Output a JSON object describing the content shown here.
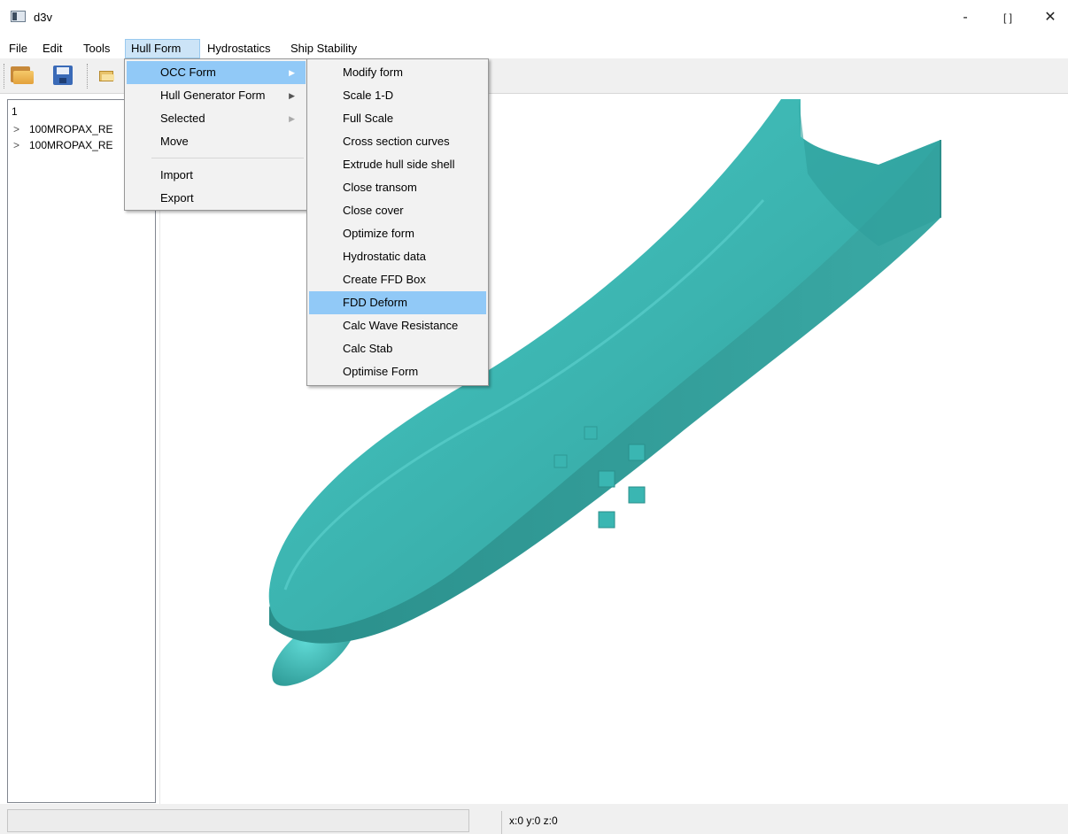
{
  "window": {
    "title": "d3v",
    "minimize": "-",
    "maximize": "[ ]",
    "close": "✕"
  },
  "menubar": {
    "items": [
      "File",
      "Edit",
      "Tools",
      "Hull Form",
      "Hydrostatics",
      "Ship Stability"
    ]
  },
  "toolbar": {
    "open_icon": "folder-open-icon",
    "save_icon": "save-icon",
    "import_icon": "open-small-icon"
  },
  "tree": {
    "root": "1",
    "items": [
      "100MROPAX_RE",
      "100MROPAX_RE"
    ]
  },
  "hull_form_menu": {
    "items": [
      "OCC Form",
      "Hull Generator Form",
      "Selected",
      "Move",
      "Import",
      "Export"
    ],
    "highlighted": "OCC Form"
  },
  "occ_form_menu": {
    "items": [
      "Modify form",
      "Scale 1-D",
      "Full Scale",
      "Cross section curves",
      "Extrude hull side shell",
      "Close transom",
      "Close cover",
      "Optimize form",
      "Hydrostatic data",
      "Create FFD Box",
      "FDD Deform",
      "Calc Wave Resistance",
      "Calc Stab",
      "Optimise Form"
    ],
    "highlighted": "FDD Deform"
  },
  "statusbar": {
    "message": "",
    "coords": "x:0 y:0 z:0"
  },
  "colors": {
    "hull": "#3fb8b4",
    "highlight": "#91c9f7",
    "menu_active": "#cce4f7"
  }
}
